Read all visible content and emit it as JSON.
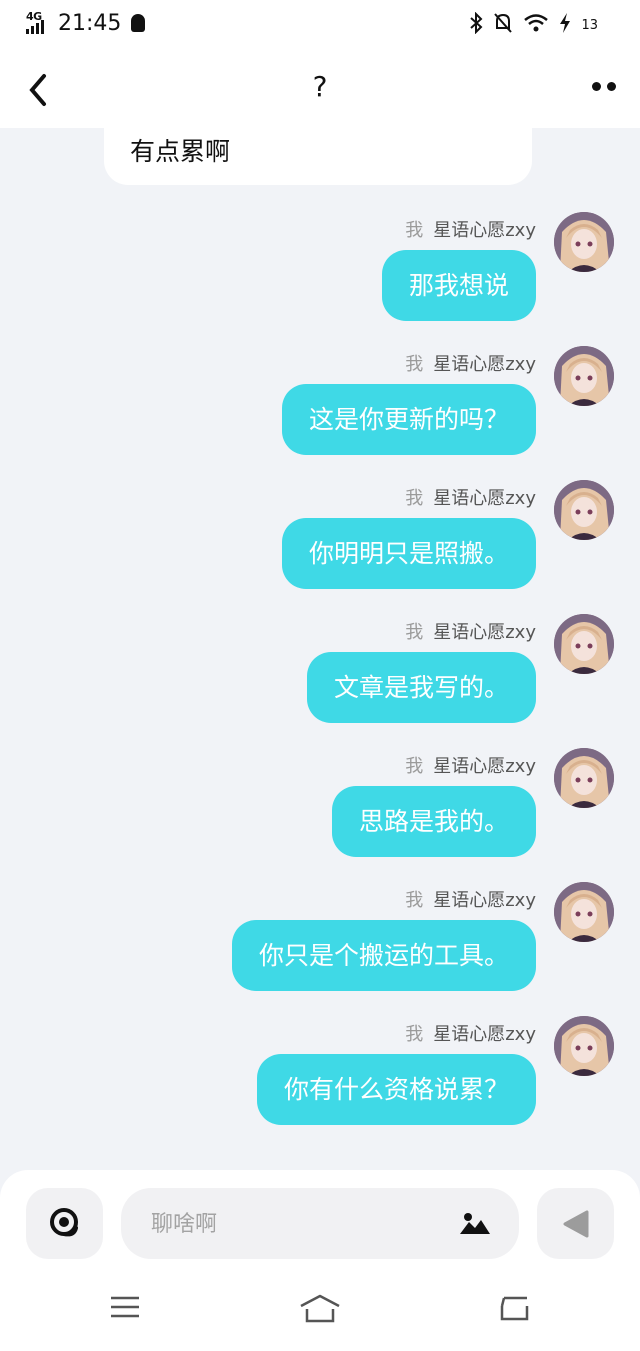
{
  "status_bar": {
    "network": "4G",
    "time": "21:45",
    "battery": "13"
  },
  "header": {
    "title": "?"
  },
  "incoming": {
    "text": "有点累啊"
  },
  "messages": [
    {
      "me_tag": "我",
      "sender": "星语心愿zxy",
      "text": "那我想说"
    },
    {
      "me_tag": "我",
      "sender": "星语心愿zxy",
      "text": "这是你更新的吗？"
    },
    {
      "me_tag": "我",
      "sender": "星语心愿zxy",
      "text": "你明明只是照搬。"
    },
    {
      "me_tag": "我",
      "sender": "星语心愿zxy",
      "text": "文章是我写的。"
    },
    {
      "me_tag": "我",
      "sender": "星语心愿zxy",
      "text": "思路是我的。"
    },
    {
      "me_tag": "我",
      "sender": "星语心愿zxy",
      "text": "你只是个搬运的工具。"
    },
    {
      "me_tag": "我",
      "sender": "星语心愿zxy",
      "text": "你有什么资格说累？"
    }
  ],
  "composer": {
    "placeholder": "聊啥啊"
  },
  "colors": {
    "bubble": "#3fd9e6",
    "background": "#f1f3f7"
  },
  "icons": [
    "back-icon",
    "more-icon",
    "voice-icon",
    "image-icon",
    "send-icon",
    "menu-icon",
    "home-icon",
    "return-icon"
  ]
}
